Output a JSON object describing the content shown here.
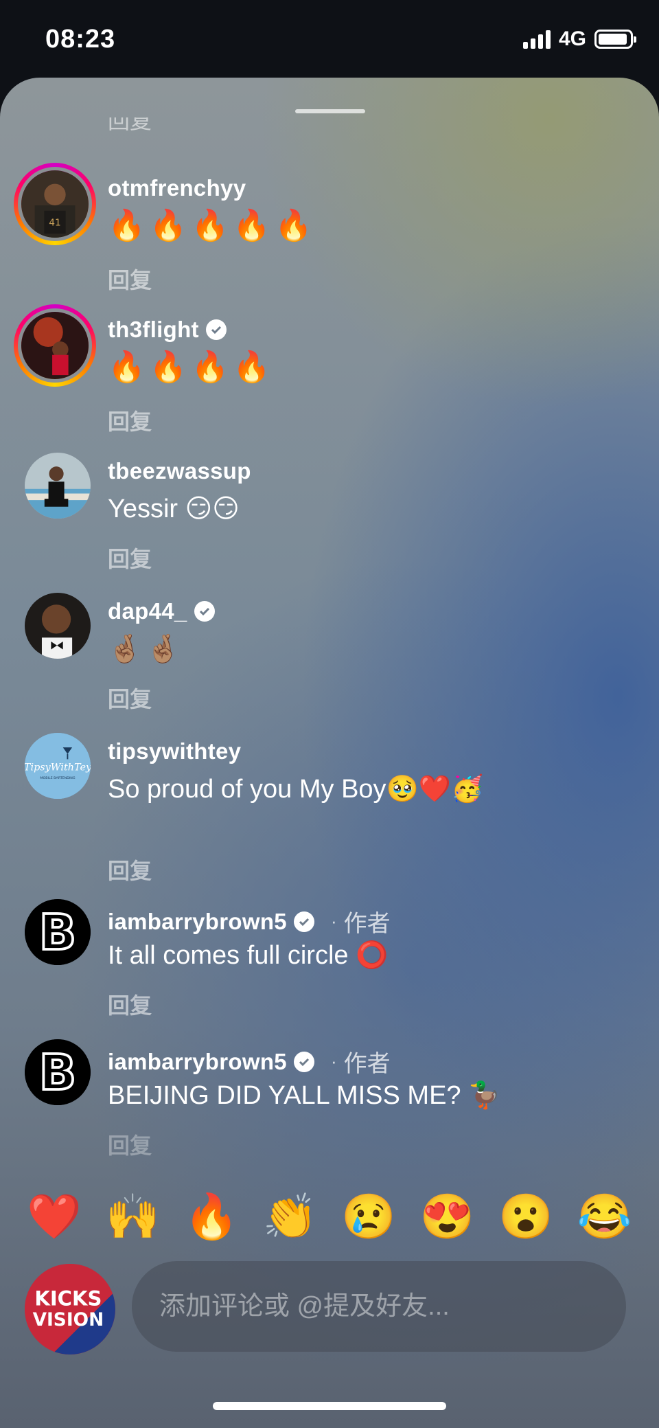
{
  "status": {
    "time": "08:23",
    "network": "4G",
    "icons": [
      "signal-icon",
      "battery-icon"
    ]
  },
  "sheet": {
    "clipped_reply": "回复"
  },
  "comments": [
    {
      "username": "otmfrenchyy",
      "verified": false,
      "text": "🔥🔥🔥🔥🔥",
      "reply": "回复",
      "story_ring": true
    },
    {
      "username": "th3flight",
      "verified": true,
      "text": "🔥🔥🔥🔥",
      "reply": "回复",
      "story_ring": true
    },
    {
      "username": "tbeezwassup",
      "verified": false,
      "text": "Yessir 😏😏",
      "reply": "回复",
      "story_ring": false
    },
    {
      "username": "dap44_",
      "verified": true,
      "text": "🤞🏽🤞🏽",
      "reply": "回复",
      "story_ring": false
    },
    {
      "username": "tipsywithtey",
      "verified": false,
      "text": "So proud of you My Boy🥹❤️🥳",
      "reply": "回复",
      "story_ring": false,
      "avatar_text": "TipsyWithTey",
      "avatar_subtext": "MOBILE BARTENDING"
    },
    {
      "username": "iambarrybrown5",
      "verified": true,
      "author_tag": "作者",
      "text": "It all comes full circle ⭕",
      "reply": "回复",
      "avatar_text": "B"
    },
    {
      "username": "iambarrybrown5",
      "verified": true,
      "author_tag": "作者",
      "text": "BEIJING DID YALL MISS ME? 🦆",
      "reply": "回复",
      "avatar_text": "B"
    }
  ],
  "separator_dot": "·",
  "quick_reactions": [
    "❤️",
    "🙌",
    "🔥",
    "👏",
    "😢",
    "😍",
    "😮",
    "😂"
  ],
  "composer": {
    "placeholder": "添加评论或 @提及好友...",
    "avatar_line1": "KICKS",
    "avatar_line2": "VISION"
  },
  "colors": {
    "accent_ring": "#ff0069",
    "kicks_vision_red": "#c8283a",
    "kicks_vision_blue": "#1f3a8a"
  }
}
